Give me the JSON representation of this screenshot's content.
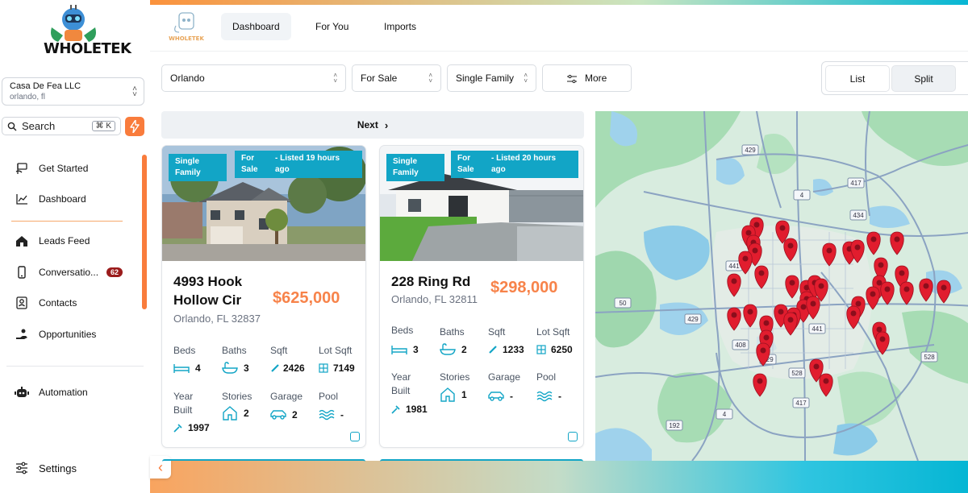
{
  "brand": {
    "logo_text": "WHOLETEK",
    "mini_logo_text": "WHOLETEK"
  },
  "sidebar": {
    "org": {
      "name": "Casa De Fea LLC",
      "location": "orlando, fl"
    },
    "search": {
      "label": "Search",
      "shortcut": "⌘ K"
    },
    "items": [
      {
        "label": "Get Started",
        "icon": "sign-icon"
      },
      {
        "label": "Dashboard",
        "icon": "chart-icon"
      },
      {
        "label": "Leads Feed",
        "icon": "home-icon"
      },
      {
        "label": "Conversatio...",
        "icon": "phone-icon",
        "badge": "62"
      },
      {
        "label": "Contacts",
        "icon": "contact-card-icon"
      },
      {
        "label": "Opportunities",
        "icon": "hand-coin-icon"
      },
      {
        "label": "Automation",
        "icon": "robot-icon"
      }
    ],
    "settings_label": "Settings"
  },
  "header": {
    "tabs": [
      {
        "label": "Dashboard",
        "active": true
      },
      {
        "label": "For You",
        "active": false
      },
      {
        "label": "Imports",
        "active": false
      }
    ]
  },
  "filters": {
    "location": "Orlando",
    "status": "For Sale",
    "property_type": "Single Family",
    "more_label": "More"
  },
  "view_toggle": {
    "list": "List",
    "split": "Split",
    "active": "Split"
  },
  "pager": {
    "next_label": "Next"
  },
  "labels": {
    "beds": "Beds",
    "baths": "Baths",
    "sqft": "Sqft",
    "lot_sqft": "Lot Sqft",
    "year_built": "Year Built",
    "stories": "Stories",
    "garage": "Garage",
    "pool": "Pool"
  },
  "listings": [
    {
      "type_tag": "Single Family",
      "status_tag": "For Sale",
      "listed_tag": "- Listed 19 hours ago",
      "address": "4993 Hook Hollow Cir",
      "city": "Orlando, FL 32837",
      "price": "$625,000",
      "beds": "4",
      "baths": "3",
      "sqft": "2426",
      "lot_sqft": "7149",
      "year_built": "1997",
      "stories": "2",
      "garage": "2",
      "pool": "-"
    },
    {
      "type_tag": "Single Family",
      "status_tag": "For Sale",
      "listed_tag": "- Listed 20 hours ago",
      "address": "228 Ring Rd",
      "city": "Orlando, FL 32811",
      "price": "$298,000",
      "beds": "3",
      "baths": "2",
      "sqft": "1233",
      "lot_sqft": "6250",
      "year_built": "1981",
      "stories": "1",
      "garage": "-",
      "pool": "-"
    }
  ],
  "map": {
    "highway_labels": [
      "429",
      "4",
      "417",
      "434",
      "441",
      "50",
      "429",
      "408",
      "528",
      "417",
      "4",
      "192",
      "528",
      "429",
      "441"
    ],
    "pin_color": "#e11d2e"
  },
  "colors": {
    "accent_orange": "#f97c3c",
    "tag_teal": "#12a5c6",
    "price_orange": "#f7834a"
  }
}
